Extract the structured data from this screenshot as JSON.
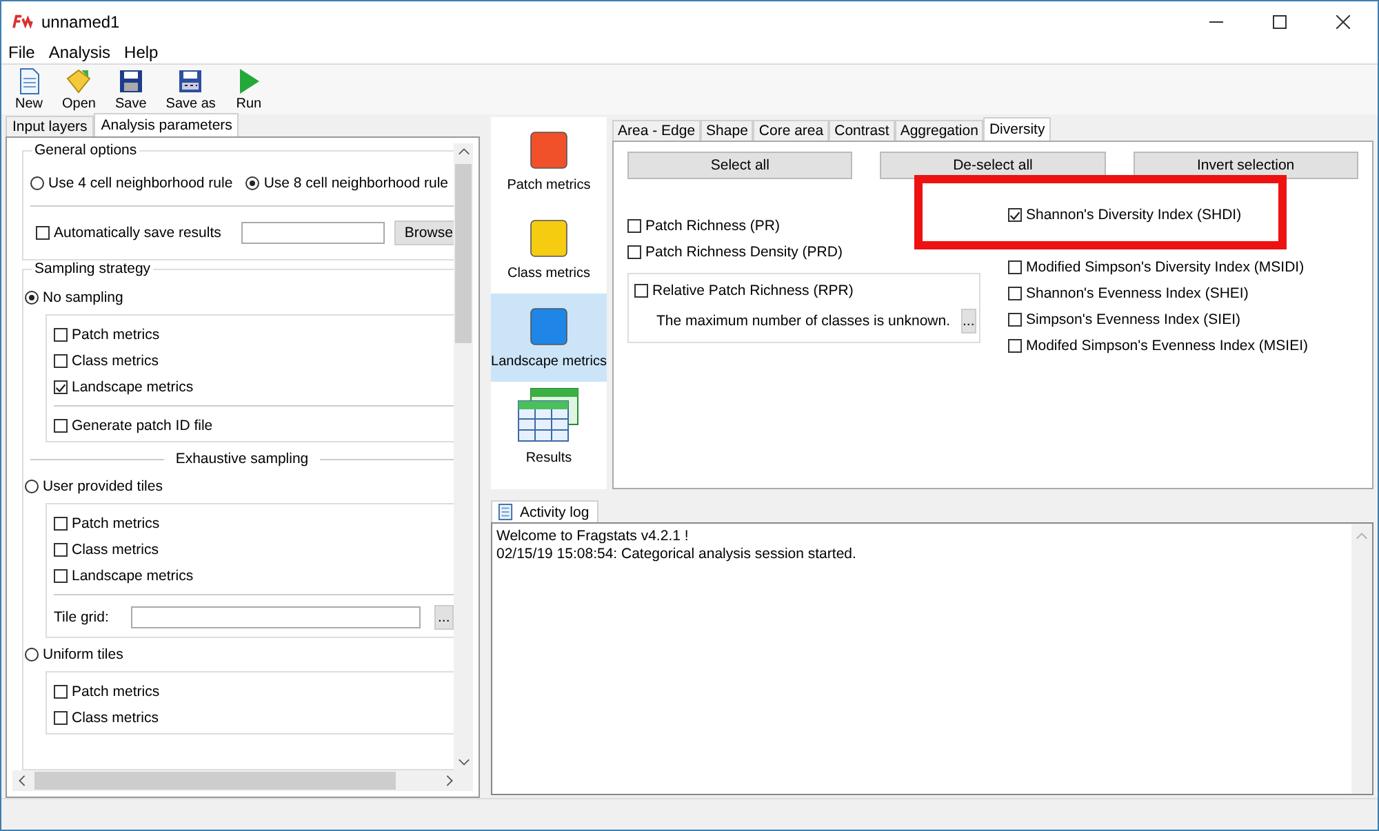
{
  "window": {
    "title": "unnamed1"
  },
  "menu": [
    "File",
    "Analysis",
    "Help"
  ],
  "toolbar": [
    {
      "label": "New",
      "kind": "new"
    },
    {
      "label": "Open",
      "kind": "open"
    },
    {
      "label": "Save",
      "kind": "save"
    },
    {
      "label": "Save as",
      "kind": "saveas"
    },
    {
      "label": "Run",
      "kind": "run"
    }
  ],
  "left_tabs": [
    {
      "label": "Input layers",
      "selected": false
    },
    {
      "label": "Analysis parameters",
      "selected": true
    }
  ],
  "general_options": {
    "title": "General options",
    "radios": [
      {
        "label": "Use 4 cell neighborhood rule",
        "selected": false
      },
      {
        "label": "Use 8 cell neighborhood rule",
        "selected": true
      }
    ],
    "autosave": {
      "label": "Automatically save results",
      "checked": false
    },
    "browse": "Browse"
  },
  "sampling": {
    "title": "Sampling strategy",
    "options": [
      {
        "label": "No sampling",
        "selected": true,
        "metrics": [
          {
            "label": "Patch metrics",
            "checked": false
          },
          {
            "label": "Class metrics",
            "checked": false
          },
          {
            "label": "Landscape metrics",
            "checked": true
          }
        ],
        "extra": {
          "label": "Generate patch ID file",
          "checked": false
        }
      },
      {
        "label": "User provided tiles",
        "selected": false,
        "divider_before": "Exhaustive sampling",
        "metrics": [
          {
            "label": "Patch metrics",
            "checked": false
          },
          {
            "label": "Class metrics",
            "checked": false
          },
          {
            "label": "Landscape metrics",
            "checked": false
          }
        ],
        "tile_grid": {
          "label": "Tile grid:",
          "button": "..."
        }
      },
      {
        "label": "Uniform tiles",
        "selected": false,
        "metrics": [
          {
            "label": "Patch metrics",
            "checked": false
          },
          {
            "label": "Class metrics",
            "checked": false
          }
        ]
      }
    ]
  },
  "nav": [
    {
      "label": "Patch metrics",
      "kind": "square",
      "color": "#f0502a",
      "selected": false
    },
    {
      "label": "Class metrics",
      "kind": "square",
      "color": "#f5cc10",
      "selected": false
    },
    {
      "label": "Landscape metrics",
      "kind": "square",
      "color": "#1f86e8",
      "selected": true
    },
    {
      "label": "Results",
      "kind": "table",
      "selected": false
    }
  ],
  "metric_tabs": [
    {
      "label": "Area - Edge",
      "selected": false
    },
    {
      "label": "Shape",
      "selected": false
    },
    {
      "label": "Core area",
      "selected": false
    },
    {
      "label": "Contrast",
      "selected": false
    },
    {
      "label": "Aggregation",
      "selected": false
    },
    {
      "label": "Diversity",
      "selected": true
    }
  ],
  "buttons": [
    "Select all",
    "De-select all",
    "Invert selection"
  ],
  "left_metrics": [
    {
      "label": "Patch Richness  (PR)",
      "checked": false
    },
    {
      "label": "Patch Richness Density  (PRD)",
      "checked": false
    }
  ],
  "rpr": {
    "label": "Relative Patch Richness  (RPR)",
    "checked": false,
    "note": "The maximum number of classes is unknown.",
    "button": "..."
  },
  "right_metrics": [
    {
      "label": "Shannon's Diversity Index  (SHDI)",
      "checked": true
    },
    {
      "kind": "hidden"
    },
    {
      "label": "Modified Simpson's Diversity Index  (MSIDI)",
      "checked": false
    },
    {
      "label": "Shannon's Evenness Index  (SHEI)",
      "checked": false
    },
    {
      "label": "Simpson's Evenness Index  (SIEI)",
      "checked": false
    },
    {
      "label": "Modifed Simpson's Evenness Index  (MSIEI)",
      "checked": false
    }
  ],
  "activity_log": {
    "tab": "Activity log",
    "lines": [
      "Welcome to Fragstats v4.2.1 !",
      "02/15/19 15:08:54: Categorical analysis session started."
    ]
  }
}
